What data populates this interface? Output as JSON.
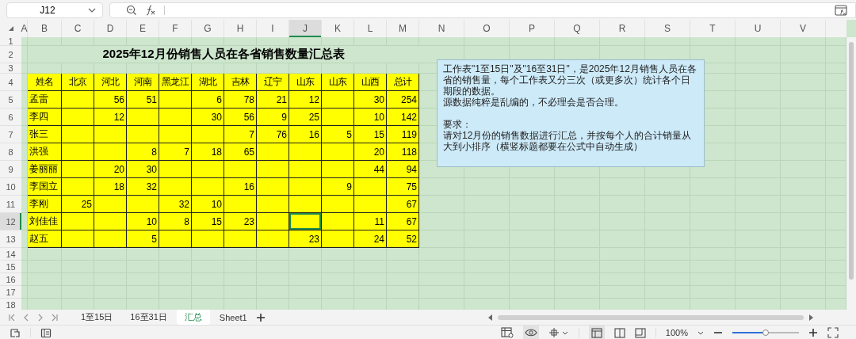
{
  "formula_bar": {
    "name_box": "J12"
  },
  "columns": [
    {
      "label": "A",
      "selected": false
    },
    {
      "label": "B",
      "selected": false
    },
    {
      "label": "C",
      "selected": false
    },
    {
      "label": "D",
      "selected": false
    },
    {
      "label": "E",
      "selected": false
    },
    {
      "label": "F",
      "selected": false
    },
    {
      "label": "G",
      "selected": false
    },
    {
      "label": "H",
      "selected": false
    },
    {
      "label": "I",
      "selected": false
    },
    {
      "label": "J",
      "selected": true
    },
    {
      "label": "K",
      "selected": false
    },
    {
      "label": "L",
      "selected": false
    },
    {
      "label": "M",
      "selected": false
    },
    {
      "label": "N",
      "selected": false
    },
    {
      "label": "O",
      "selected": false
    },
    {
      "label": "P",
      "selected": false
    },
    {
      "label": "Q",
      "selected": false
    },
    {
      "label": "R",
      "selected": false
    },
    {
      "label": "S",
      "selected": false
    },
    {
      "label": "T",
      "selected": false
    },
    {
      "label": "U",
      "selected": false
    },
    {
      "label": "V",
      "selected": false
    }
  ],
  "rows": [
    {
      "label": "1",
      "selected": false
    },
    {
      "label": "2",
      "selected": false
    },
    {
      "label": "3",
      "selected": false
    },
    {
      "label": "4",
      "selected": false
    },
    {
      "label": "5",
      "selected": false
    },
    {
      "label": "6",
      "selected": false
    },
    {
      "label": "7",
      "selected": false
    },
    {
      "label": "8",
      "selected": false
    },
    {
      "label": "9",
      "selected": false
    },
    {
      "label": "10",
      "selected": false
    },
    {
      "label": "11",
      "selected": false
    },
    {
      "label": "12",
      "selected": true
    },
    {
      "label": "13",
      "selected": false
    },
    {
      "label": "14",
      "selected": false
    },
    {
      "label": "15",
      "selected": false
    },
    {
      "label": "16",
      "selected": false
    },
    {
      "label": "17",
      "selected": false
    },
    {
      "label": "18",
      "selected": false
    }
  ],
  "title": "2025年12月份销售人员在各省销售数量汇总表",
  "table": {
    "header": [
      "姓名",
      "北京",
      "河北",
      "河南",
      "黑龙江",
      "湖北",
      "吉林",
      "辽宁",
      "山东",
      "山东",
      "山西",
      "总计"
    ],
    "rows": [
      [
        "孟雷",
        null,
        "56",
        "51",
        null,
        "6",
        "78",
        "21",
        "12",
        null,
        "30",
        "254"
      ],
      [
        "李四",
        null,
        "12",
        null,
        null,
        "30",
        "56",
        "9",
        "25",
        null,
        "10",
        "142"
      ],
      [
        "张三",
        null,
        null,
        null,
        null,
        null,
        "7",
        "76",
        "16",
        "5",
        "15",
        "119"
      ],
      [
        "洪强",
        null,
        null,
        "8",
        "7",
        "18",
        "65",
        null,
        null,
        null,
        "20",
        "118"
      ],
      [
        "姜丽丽",
        null,
        "20",
        "30",
        null,
        null,
        null,
        null,
        null,
        null,
        "44",
        "94"
      ],
      [
        "李国立",
        null,
        "18",
        "32",
        null,
        null,
        "16",
        null,
        null,
        "9",
        null,
        "75"
      ],
      [
        "李刚",
        "25",
        null,
        null,
        "32",
        "10",
        null,
        null,
        null,
        null,
        null,
        "67"
      ],
      [
        "刘佳佳",
        null,
        null,
        "10",
        "8",
        "15",
        "23",
        null,
        null,
        null,
        "11",
        "67"
      ],
      [
        "赵五",
        null,
        null,
        "5",
        null,
        null,
        null,
        null,
        "23",
        null,
        "24",
        "52"
      ]
    ]
  },
  "note": [
    "工作表\"1至15日\"及\"16至31日\"，是2025年12月销售人员在各省的销售量，每个工作表又分三次（或更多次）统计各个日期段的数据。",
    "源数据纯粹是乱编的，不必理会是否合理。",
    "要求：",
    "请对12月份的销售数据进行汇总，并按每个人的合计销量从大到小排序（横竖标题都要在公式中自动生成）"
  ],
  "sheet_tabs": [
    {
      "label": "1至15日",
      "selected": false
    },
    {
      "label": "16至31日",
      "selected": false
    },
    {
      "label": "汇总",
      "selected": true
    },
    {
      "label": "Sheet1",
      "selected": false
    }
  ],
  "zoom": {
    "reading": "100%",
    "level": 0.5
  }
}
